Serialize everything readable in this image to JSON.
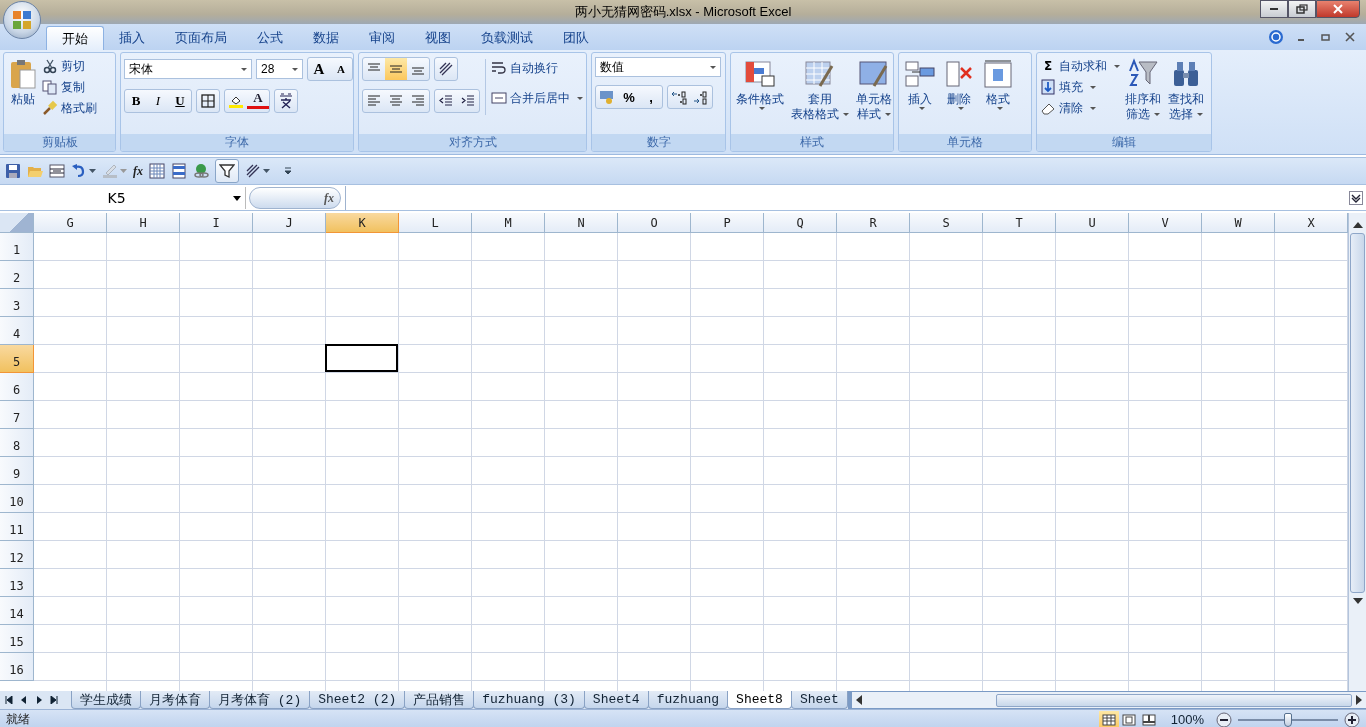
{
  "title_bar": {
    "title": "两小无猜网密码.xlsx - Microsoft Excel"
  },
  "ribbon_tabs": [
    {
      "label": "开始",
      "selected": true
    },
    {
      "label": "插入",
      "selected": false
    },
    {
      "label": "页面布局",
      "selected": false
    },
    {
      "label": "公式",
      "selected": false
    },
    {
      "label": "数据",
      "selected": false
    },
    {
      "label": "审阅",
      "selected": false
    },
    {
      "label": "视图",
      "selected": false
    },
    {
      "label": "负载测试",
      "selected": false
    },
    {
      "label": "团队",
      "selected": false
    }
  ],
  "clipboard": {
    "label": "剪贴板",
    "paste": "粘贴",
    "cut": "剪切",
    "copy": "复制",
    "format_painter": "格式刷"
  },
  "font": {
    "label": "字体",
    "font_name": "宋体",
    "font_size": "28",
    "grow": "A",
    "shrink": "A",
    "bold": "B",
    "italic": "I",
    "underline": "U",
    "font_color": "A"
  },
  "alignment": {
    "label": "对齐方式",
    "wrap_text": "自动换行",
    "merge_center": "合并后居中",
    "vertical": [
      {
        "selected": false
      },
      {
        "selected": true
      },
      {
        "selected": false
      }
    ]
  },
  "number": {
    "label": "数字",
    "format": "数值",
    "percent": "%",
    "comma": ","
  },
  "styles": {
    "label": "样式",
    "conditional": "条件格式",
    "table_format": [
      "套用",
      "表格格式"
    ],
    "cell_styles": [
      "单元格",
      "样式"
    ]
  },
  "cells": {
    "label": "单元格",
    "insert": "插入",
    "delete": "删除",
    "format": "格式"
  },
  "editing": {
    "label": "编辑",
    "autosum_symbol": "Σ",
    "autosum": "自动求和",
    "fill": "填充",
    "clear": "清除",
    "sort_filter": [
      "排序和",
      "筛选"
    ],
    "find_select": [
      "查找和",
      "选择"
    ]
  },
  "quick_access": {
    "fx": "fx",
    "filter_on": true
  },
  "formula_bar": {
    "name_box": "K5",
    "fx": "fx"
  },
  "grid": {
    "columns": [
      {
        "label": "G",
        "selected": false
      },
      {
        "label": "H",
        "selected": false
      },
      {
        "label": "I",
        "selected": false
      },
      {
        "label": "J",
        "selected": false
      },
      {
        "label": "K",
        "selected": true
      },
      {
        "label": "L",
        "selected": false
      },
      {
        "label": "M",
        "selected": false
      },
      {
        "label": "N",
        "selected": false
      },
      {
        "label": "O",
        "selected": false
      },
      {
        "label": "P",
        "selected": false
      },
      {
        "label": "Q",
        "selected": false
      },
      {
        "label": "R",
        "selected": false
      },
      {
        "label": "S",
        "selected": false
      },
      {
        "label": "T",
        "selected": false
      },
      {
        "label": "U",
        "selected": false
      },
      {
        "label": "V",
        "selected": false
      },
      {
        "label": "W",
        "selected": false
      },
      {
        "label": "X",
        "selected": false
      }
    ],
    "rows": [
      {
        "label": "1",
        "selected": false
      },
      {
        "label": "2",
        "selected": false
      },
      {
        "label": "3",
        "selected": false
      },
      {
        "label": "4",
        "selected": false
      },
      {
        "label": "5",
        "selected": true
      },
      {
        "label": "6",
        "selected": false
      },
      {
        "label": "7",
        "selected": false
      },
      {
        "label": "8",
        "selected": false
      },
      {
        "label": "9",
        "selected": false
      },
      {
        "label": "10",
        "selected": false
      },
      {
        "label": "11",
        "selected": false
      },
      {
        "label": "12",
        "selected": false
      },
      {
        "label": "13",
        "selected": false
      },
      {
        "label": "14",
        "selected": false
      },
      {
        "label": "15",
        "selected": false
      },
      {
        "label": "16",
        "selected": false
      }
    ]
  },
  "sheet_tabs": [
    {
      "label": "学生成绩",
      "selected": false
    },
    {
      "label": "月考体育",
      "selected": false
    },
    {
      "label": "月考体育 (2)",
      "selected": false
    },
    {
      "label": "Sheet2 (2)",
      "selected": false
    },
    {
      "label": "产品销售",
      "selected": false
    },
    {
      "label": "fuzhuang (3)",
      "selected": false
    },
    {
      "label": "Sheet4",
      "selected": false
    },
    {
      "label": "fuzhuang",
      "selected": false
    },
    {
      "label": "Sheet8",
      "selected": true
    },
    {
      "label": "Sheet",
      "selected": false
    }
  ],
  "status_bar": {
    "status": "就绪",
    "zoom": "100%",
    "zoom_slider": {
      "level": 0.5
    },
    "views": [
      {
        "selected": true
      },
      {
        "selected": false
      },
      {
        "selected": false
      }
    ]
  }
}
